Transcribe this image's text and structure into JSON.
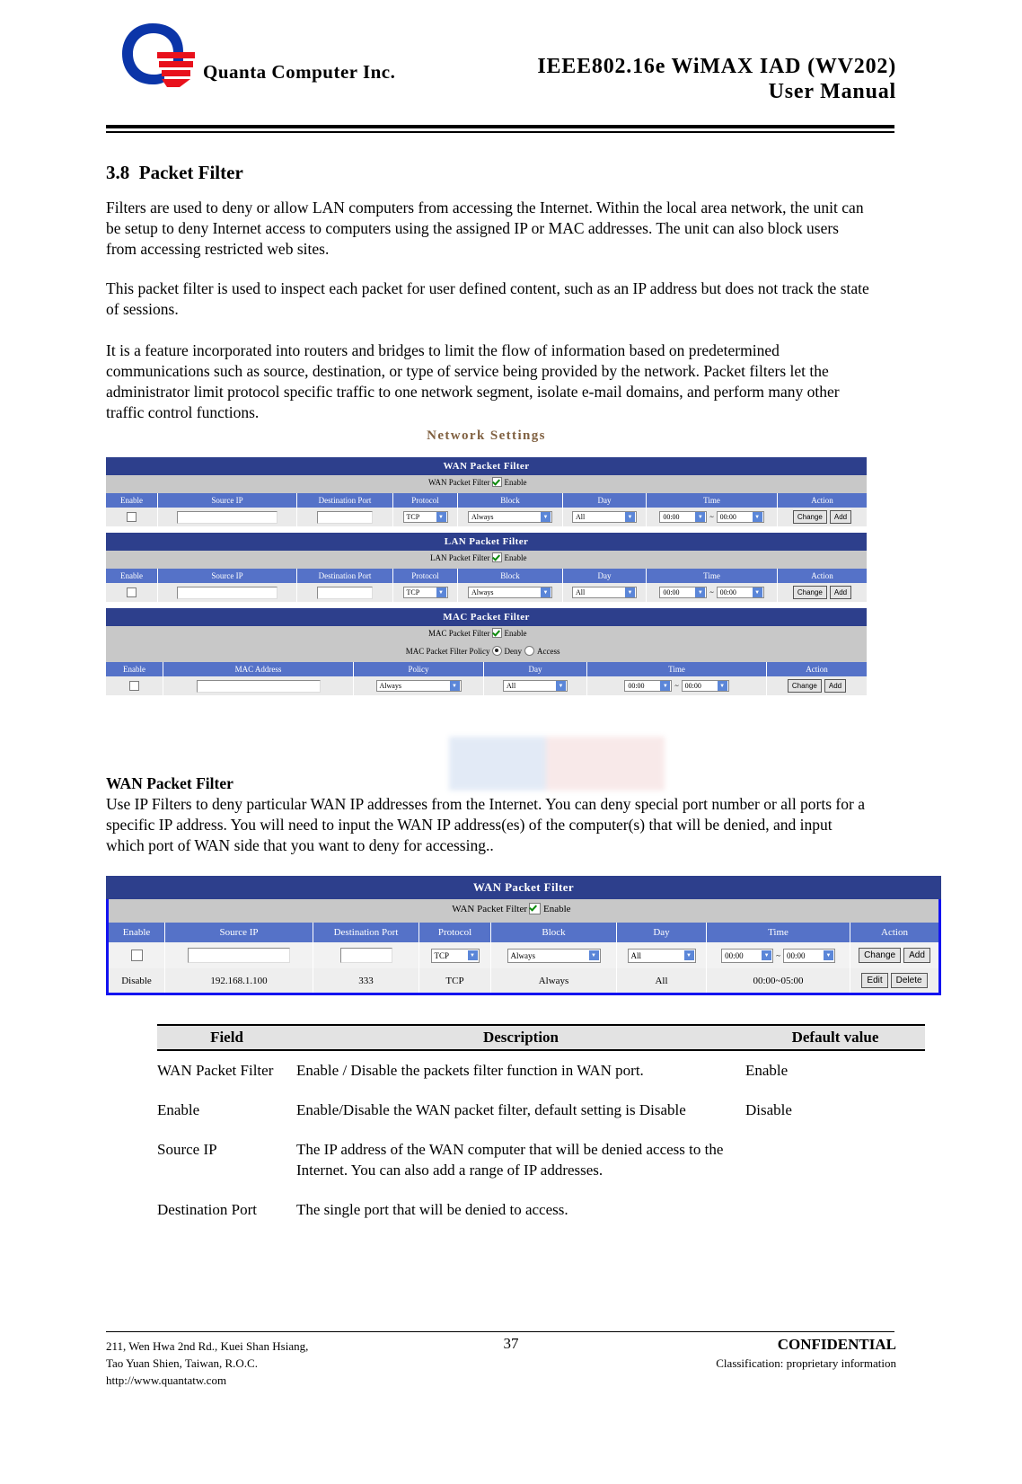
{
  "header": {
    "company": "Quanta  Computer  Inc.",
    "title_line1": "IEEE802.16e  WiMAX  IAD  (WV202)",
    "title_line2": "User  Manual",
    "logo_name": "quanta-logo"
  },
  "section": {
    "number": "3.8",
    "heading": "Packet Filter",
    "paragraph1": "Filters are used to deny or allow LAN computers from accessing the Internet. Within the local area network, the unit can be setup to deny Internet access to computers using the assigned IP or MAC addresses. The unit can also block users from accessing restricted web sites.",
    "paragraph2": "This packet filter is used to inspect each packet for user defined content, such as an IP address but does not track the state of sessions.",
    "paragraph3": "It is a feature incorporated into routers and bridges to limit the flow of information based on predetermined communications such as source, destination, or type of service being provided by the network. Packet filters let the administrator limit protocol specific traffic to one network segment, isolate e-mail domains, and perform many other traffic control functions."
  },
  "screenshot1": {
    "page_title": "Network Settings",
    "panels": [
      {
        "title": "WAN Packet Filter",
        "toggle_label": "WAN Packet Filter",
        "toggle_text": "Enable",
        "toggle_checked": true,
        "columns": [
          "Enable",
          "Source IP",
          "Destination Port",
          "Protocol",
          "Block",
          "Day",
          "Time",
          "Action"
        ],
        "protocol_value": "TCP",
        "block_value": "Always",
        "day_value": "All",
        "time_from": "00:00",
        "time_to": "00:00",
        "time_sep": "~",
        "btn_change": "Change",
        "btn_add": "Add"
      },
      {
        "title": "LAN Packet Filter",
        "toggle_label": "LAN Packet Filter",
        "toggle_text": "Enable",
        "toggle_checked": true,
        "columns": [
          "Enable",
          "Source IP",
          "Destination Port",
          "Protocol",
          "Block",
          "Day",
          "Time",
          "Action"
        ],
        "protocol_value": "TCP",
        "block_value": "Always",
        "day_value": "All",
        "time_from": "00:00",
        "time_to": "00:00",
        "time_sep": "~",
        "btn_change": "Change",
        "btn_add": "Add"
      },
      {
        "title": "MAC Packet Filter",
        "toggle_label": "MAC Packet Filter",
        "toggle_text": "Enable",
        "toggle_checked": true,
        "policy_label": "MAC Packet Filter Policy",
        "policy_opt1": "Deny",
        "policy_opt2": "Access",
        "policy_selected": "Deny",
        "columns": [
          "Enable",
          "MAC Address",
          "Policy",
          "Day",
          "Time",
          "Action"
        ],
        "policy_value": "Always",
        "day_value": "All",
        "time_from": "00:00",
        "time_to": "00:00",
        "time_sep": "~",
        "btn_change": "Change",
        "btn_add": "Add"
      }
    ]
  },
  "wan_section": {
    "heading": "WAN Packet Filter",
    "paragraph": "Use IP Filters to deny particular WAN IP addresses from the Internet. You can deny special port number or all ports for a specific IP address. You will need to input the WAN IP address(es) of the computer(s) that will be denied, and input which port of WAN side that you want to deny for accessing.."
  },
  "screenshot2": {
    "title": "WAN Packet Filter",
    "toggle_label": "WAN Packet Filter",
    "toggle_text": "Enable",
    "toggle_checked": true,
    "columns": [
      "Enable",
      "Source IP",
      "Destination Port",
      "Protocol",
      "Block",
      "Day",
      "Time",
      "Action"
    ],
    "form_row": {
      "enable_checked": false,
      "source_ip": "",
      "destination_port": "",
      "protocol": "TCP",
      "block": "Always",
      "day": "All",
      "time_from": "00:00",
      "time_to": "00:00",
      "time_sep": "~",
      "btn_change": "Change",
      "btn_add": "Add"
    },
    "entry_row": {
      "enable": "Disable",
      "source_ip": "192.168.1.100",
      "destination_port": "333",
      "protocol": "TCP",
      "block": "Always",
      "day": "All",
      "time": "00:00~05:00",
      "btn_edit": "Edit",
      "btn_delete": "Delete"
    },
    "highlight_color": "#1313f0"
  },
  "field_table": {
    "headers": [
      "Field",
      "Description",
      "Default value"
    ],
    "rows": [
      {
        "field": "WAN Packet Filter",
        "description": "Enable / Disable the packets filter function in WAN port.",
        "default": "Enable"
      },
      {
        "field": "Enable",
        "description": "Enable/Disable the WAN packet filter, default setting is Disable",
        "default": "Disable"
      },
      {
        "field": "Source IP",
        "description": "The IP address of the WAN computer that will be denied access to the Internet. You can also add a range of IP addresses.",
        "default": ""
      },
      {
        "field": "Destination Port",
        "description": "The single port that will be denied to access.",
        "default": ""
      }
    ]
  },
  "footer": {
    "address_line1": "211, Wen Hwa 2nd Rd., Kuei Shan Hsiang,",
    "address_line2": "Tao Yuan Shien, Taiwan, R.O.C.",
    "address_line3": "http://www.quantatw.com",
    "page_number": "37",
    "confidential": "CONFIDENTIAL",
    "classification": "Classification: proprietary information"
  }
}
